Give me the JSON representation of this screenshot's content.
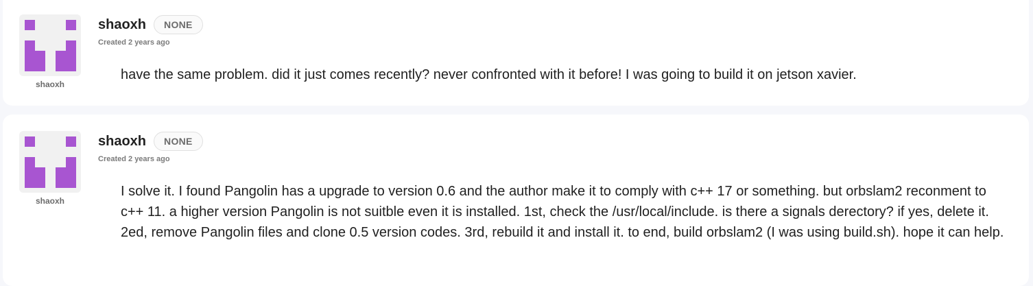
{
  "comments": [
    {
      "username": "shaoxh",
      "role": "NONE",
      "created": "Created 2 years ago",
      "avatar_label": "shaoxh",
      "body": "have the same problem. did it just comes recently? never confronted with it before! I was going to build it on jetson xavier."
    },
    {
      "username": "shaoxh",
      "role": "NONE",
      "created": "Created 2 years ago",
      "avatar_label": "shaoxh",
      "body": "I solve it. I found Pangolin has a upgrade to version 0.6 and the author make it to comply with c++ 17 or something. but orbslam2 reconment to c++ 11. a higher version Pangolin is not suitble even it is installed. 1st, check the /usr/local/include. is there a signals derectory? if yes, delete it. 2ed, remove Pangolin files and clone 0.5 version codes. 3rd, rebuild it and install it. to end, build orbslam2 (I was using build.sh). hope it can help."
    }
  ],
  "colors": {
    "avatar_accent": "#a855d1",
    "page_bg": "#f6f7fb",
    "card_bg": "#ffffff"
  }
}
